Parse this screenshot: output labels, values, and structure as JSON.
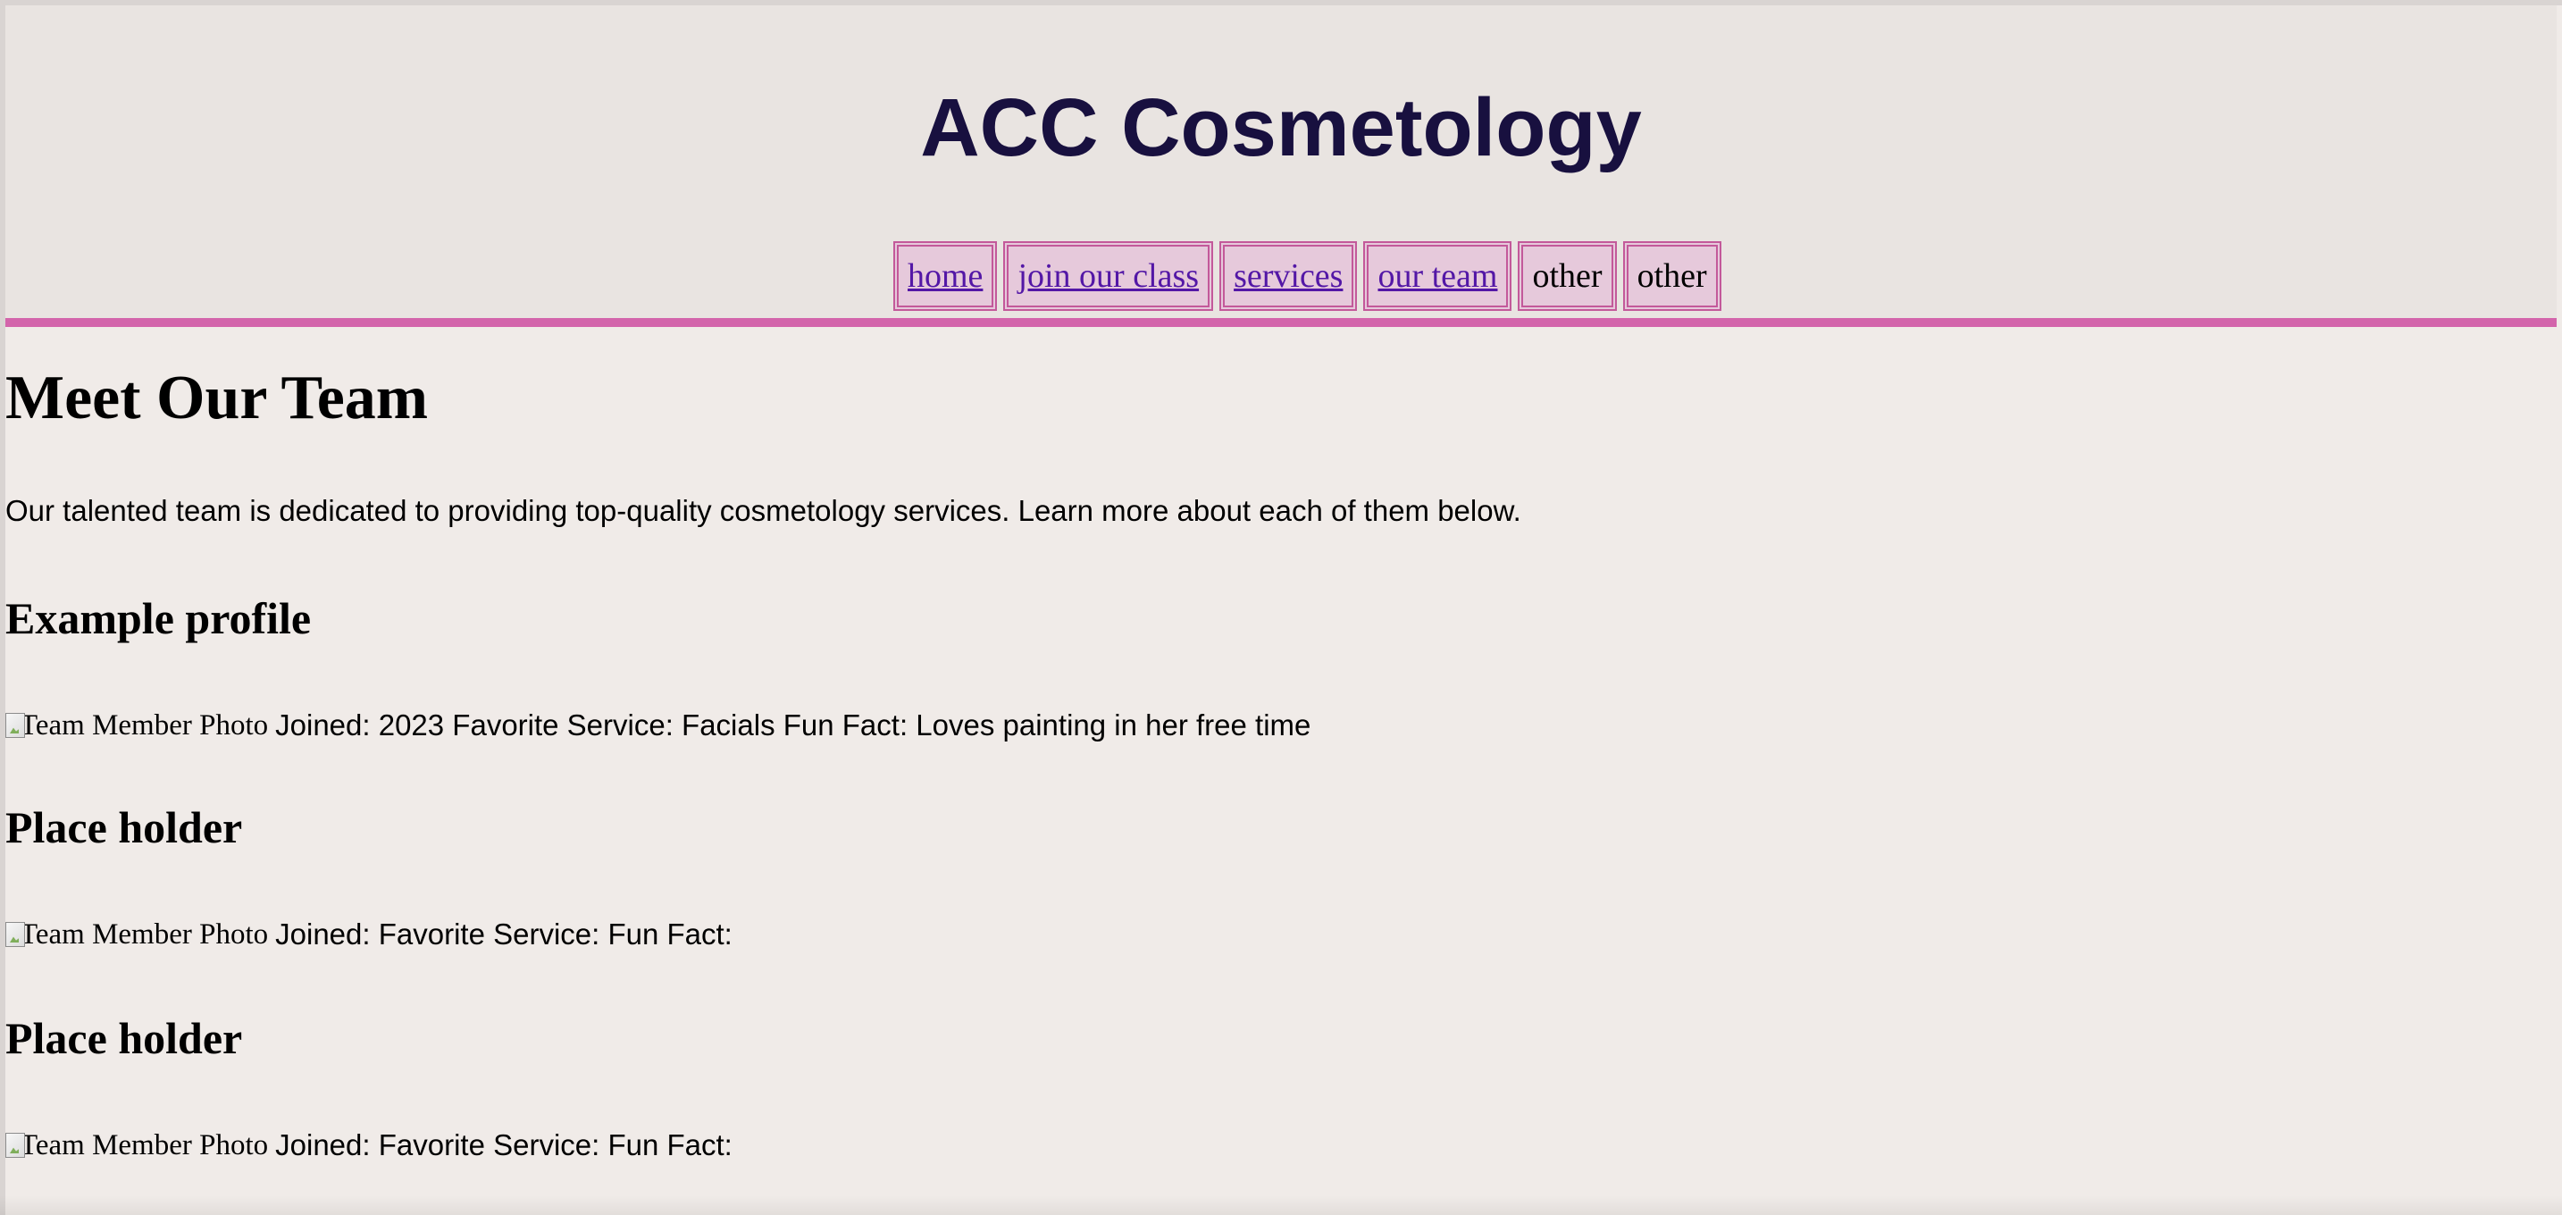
{
  "site": {
    "title": "ACC Cosmetology"
  },
  "nav": {
    "items": [
      {
        "label": "home",
        "link": true
      },
      {
        "label": "join our class",
        "link": true
      },
      {
        "label": "services",
        "link": true
      },
      {
        "label": "our team",
        "link": true
      },
      {
        "label": "other",
        "link": false
      },
      {
        "label": "other",
        "link": false
      }
    ]
  },
  "page": {
    "heading": "Meet Our Team",
    "intro": "Our talented team is dedicated to providing top-quality cosmetology services. Learn more about each of them below."
  },
  "profiles": [
    {
      "title": "Example profile",
      "photo_alt": "Team Member Photo",
      "details": "Joined: 2023 Favorite Service: Facials Fun Fact: Loves painting in her free time"
    },
    {
      "title": "Place holder",
      "photo_alt": "Team Member Photo",
      "details": "Joined: Favorite Service: Fun Fact:"
    },
    {
      "title": "Place holder",
      "photo_alt": "Team Member Photo",
      "details": "Joined: Favorite Service: Fun Fact:"
    }
  ],
  "colors": {
    "header_bg": "#e9e4e1",
    "accent": "#d364ab",
    "title": "#18103f",
    "link": "#5317a6",
    "nav_bg": "#e6c9db",
    "page_bg": "#f0ebe8"
  }
}
